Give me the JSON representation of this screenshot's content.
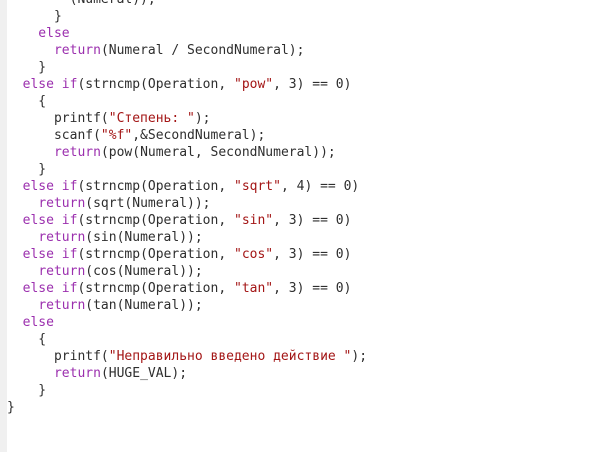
{
  "colors": {
    "keyword": "#9b2fae",
    "string": "#a31515",
    "plain": "#2e2e2e",
    "background": "#ffffff",
    "gutter": "#f0f0f0"
  },
  "lines": [
    [
      {
        "t": "plain",
        "v": "        (Numeral));"
      }
    ],
    [
      {
        "t": "plain",
        "v": "      }"
      }
    ],
    [
      {
        "t": "keyword",
        "v": "    else"
      }
    ],
    [
      {
        "t": "plain",
        "v": "      "
      },
      {
        "t": "keyword",
        "v": "return"
      },
      {
        "t": "plain",
        "v": "(Numeral / SecondNumeral);"
      }
    ],
    [
      {
        "t": "plain",
        "v": "    }"
      }
    ],
    [
      {
        "t": "plain",
        "v": "  "
      },
      {
        "t": "keyword",
        "v": "else if"
      },
      {
        "t": "plain",
        "v": "(strncmp(Operation, "
      },
      {
        "t": "string",
        "v": "\"pow\""
      },
      {
        "t": "plain",
        "v": ", 3) == 0)"
      }
    ],
    [
      {
        "t": "plain",
        "v": "    {"
      }
    ],
    [
      {
        "t": "plain",
        "v": "      printf("
      },
      {
        "t": "string",
        "v": "\"Степень: \""
      },
      {
        "t": "plain",
        "v": ");"
      }
    ],
    [
      {
        "t": "plain",
        "v": "      scanf("
      },
      {
        "t": "string",
        "v": "\"%f\""
      },
      {
        "t": "plain",
        "v": ",&SecondNumeral);"
      }
    ],
    [
      {
        "t": "plain",
        "v": "      "
      },
      {
        "t": "keyword",
        "v": "return"
      },
      {
        "t": "plain",
        "v": "(pow(Numeral, SecondNumeral));"
      }
    ],
    [
      {
        "t": "plain",
        "v": "    }"
      }
    ],
    [
      {
        "t": "plain",
        "v": "  "
      },
      {
        "t": "keyword",
        "v": "else if"
      },
      {
        "t": "plain",
        "v": "(strncmp(Operation, "
      },
      {
        "t": "string",
        "v": "\"sqrt\""
      },
      {
        "t": "plain",
        "v": ", 4) == 0)"
      }
    ],
    [
      {
        "t": "plain",
        "v": "    "
      },
      {
        "t": "keyword",
        "v": "return"
      },
      {
        "t": "plain",
        "v": "(sqrt(Numeral));"
      }
    ],
    [
      {
        "t": "plain",
        "v": "  "
      },
      {
        "t": "keyword",
        "v": "else if"
      },
      {
        "t": "plain",
        "v": "(strncmp(Operation, "
      },
      {
        "t": "string",
        "v": "\"sin\""
      },
      {
        "t": "plain",
        "v": ", 3) == 0)"
      }
    ],
    [
      {
        "t": "plain",
        "v": "    "
      },
      {
        "t": "keyword",
        "v": "return"
      },
      {
        "t": "plain",
        "v": "(sin(Numeral));"
      }
    ],
    [
      {
        "t": "plain",
        "v": "  "
      },
      {
        "t": "keyword",
        "v": "else if"
      },
      {
        "t": "plain",
        "v": "(strncmp(Operation, "
      },
      {
        "t": "string",
        "v": "\"cos\""
      },
      {
        "t": "plain",
        "v": ", 3) == 0)"
      }
    ],
    [
      {
        "t": "plain",
        "v": "    "
      },
      {
        "t": "keyword",
        "v": "return"
      },
      {
        "t": "plain",
        "v": "(cos(Numeral));"
      }
    ],
    [
      {
        "t": "plain",
        "v": "  "
      },
      {
        "t": "keyword",
        "v": "else if"
      },
      {
        "t": "plain",
        "v": "(strncmp(Operation, "
      },
      {
        "t": "string",
        "v": "\"tan\""
      },
      {
        "t": "plain",
        "v": ", 3) == 0)"
      }
    ],
    [
      {
        "t": "plain",
        "v": "    "
      },
      {
        "t": "keyword",
        "v": "return"
      },
      {
        "t": "plain",
        "v": "(tan(Numeral));"
      }
    ],
    [
      {
        "t": "keyword",
        "v": "  else"
      }
    ],
    [
      {
        "t": "plain",
        "v": "    {"
      }
    ],
    [
      {
        "t": "plain",
        "v": "      printf("
      },
      {
        "t": "string",
        "v": "\"Неправильно введено действие \""
      },
      {
        "t": "plain",
        "v": ");"
      }
    ],
    [
      {
        "t": "plain",
        "v": "      "
      },
      {
        "t": "keyword",
        "v": "return"
      },
      {
        "t": "plain",
        "v": "(HUGE_VAL);"
      }
    ],
    [
      {
        "t": "plain",
        "v": "    }"
      }
    ],
    [
      {
        "t": "plain",
        "v": "}"
      }
    ]
  ]
}
